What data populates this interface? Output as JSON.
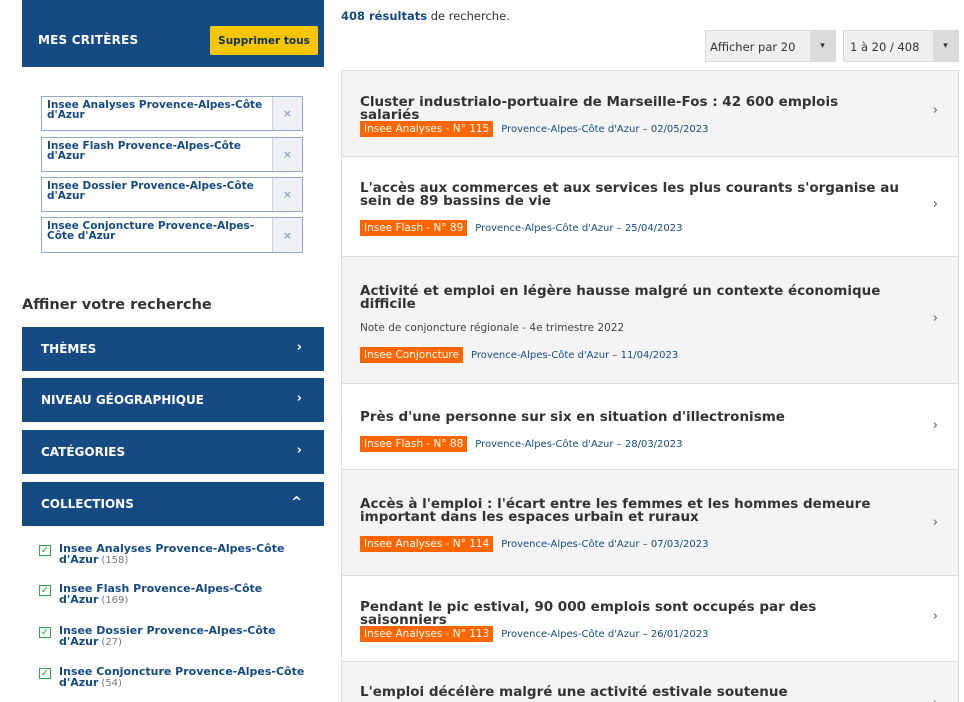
{
  "criteria": {
    "title": "MES CRITÈRES",
    "clear_label": "Supprimer tous",
    "remove_icon": "×",
    "tags": [
      "Insee Analyses Provence-Alpes-Côte d'Azur",
      "Insee Flash Provence-Alpes-Côte d'Azur",
      "Insee Dossier Provence-Alpes-Côte d'Azur",
      "Insee Conjoncture Provence-Alpes-Côte d'Azur"
    ]
  },
  "refine": {
    "title": "Affiner votre recherche",
    "facets": [
      {
        "label": "THÈMES",
        "icon": "›"
      },
      {
        "label": "NIVEAU GÉOGRAPHIQUE",
        "icon": "›"
      },
      {
        "label": "CATÉGORIES",
        "icon": "›"
      },
      {
        "label": "COLLECTIONS",
        "icon": "^"
      }
    ],
    "collections": [
      {
        "label": "Insee Analyses Provence-Alpes-Côte d'Azur",
        "count": "(158)"
      },
      {
        "label": "Insee Flash Provence-Alpes-Côte d'Azur",
        "count": "(169)"
      },
      {
        "label": "Insee Dossier Provence-Alpes-Côte d'Azur",
        "count": "(27)"
      },
      {
        "label": "Insee Conjoncture Provence-Alpes-Côte d'Azur",
        "count": "(54)"
      }
    ],
    "check_icon": "✓"
  },
  "results_header": {
    "count": "408 résultats",
    "count_suffix": " de recherche."
  },
  "per_page": {
    "label": "Afficher par 20",
    "arrow": "▾"
  },
  "pagination": {
    "label": "1 à 20 / 408",
    "arrow": "▾"
  },
  "results": [
    {
      "title": "Cluster industrialo-portuaire de Marseille-Fos : 42 600 emplois salariés",
      "badge": "Insee Analyses - N° 115",
      "meta": "Provence-Alpes-Côte d'Azur – 02/05/2023",
      "chevron": "›"
    },
    {
      "title": "L'accès aux commerces et aux services les plus courants s'organise au sein de 89 bassins de vie",
      "badge": "Insee Flash - N° 89",
      "meta": "Provence-Alpes-Côte d'Azur – 25/04/2023",
      "chevron": "›"
    },
    {
      "title": "Activité et emploi en légère hausse malgré un contexte économique difficile",
      "subtitle": "Note de conjoncture régionale - 4e trimestre 2022",
      "badge": "Insee Conjoncture",
      "meta": "Provence-Alpes-Côte d'Azur – 11/04/2023",
      "chevron": "›"
    },
    {
      "title": "Près d'une personne sur six en situation d'illectronisme",
      "badge": "Insee Flash - N° 88",
      "meta": "Provence-Alpes-Côte d'Azur – 28/03/2023",
      "chevron": "›"
    },
    {
      "title": "Accès à l'emploi : l'écart entre les femmes et les hommes demeure important dans les espaces urbain et ruraux",
      "badge": "Insee Analyses - N° 114",
      "meta": "Provence-Alpes-Côte d'Azur – 07/03/2023",
      "chevron": "›"
    },
    {
      "title": "Pendant le pic estival, 90 000 emplois sont occupés par des saisonniers",
      "badge": "Insee Analyses - N° 113",
      "meta": "Provence-Alpes-Côte d'Azur – 26/01/2023",
      "chevron": "›"
    },
    {
      "title": "L'emploi décélère malgré une activité estivale soutenue",
      "chevron": "›"
    }
  ],
  "colors": {
    "navy": "#154b82",
    "yellow": "#f7c600",
    "orange": "#ff6600",
    "green": "#3aa04a"
  }
}
